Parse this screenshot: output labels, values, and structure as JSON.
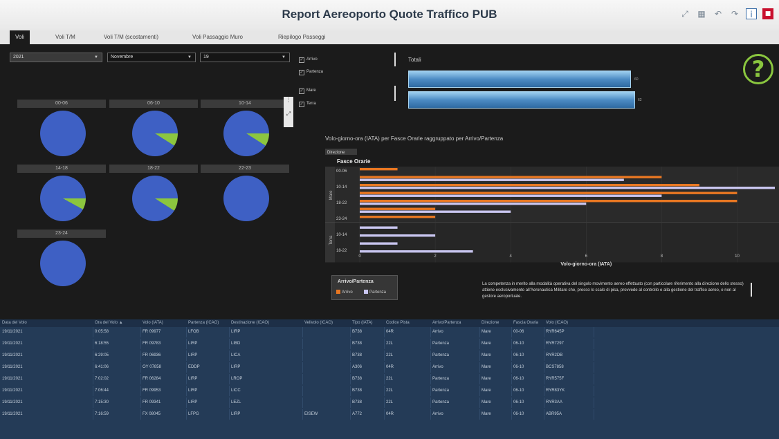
{
  "title": "Report Aereoporto Quote Traffico PUB",
  "toolbar": {
    "icons": [
      "expand-icon",
      "grid-icon",
      "undo-icon",
      "redo-icon",
      "info-icon",
      "app-icon"
    ]
  },
  "tabs": [
    "Voli",
    "Voli T/M",
    "Voli T/M (scostamenti)",
    "Voli Passaggio Muro",
    "Riepilogo Passeggi"
  ],
  "filters": {
    "year": "2021",
    "month": "Novembre",
    "day": "19"
  },
  "checkboxes": [
    {
      "label": "Arrivo",
      "checked": true
    },
    {
      "label": "Partenza",
      "checked": true
    },
    {
      "label": "Mare",
      "checked": true
    },
    {
      "label": "Terra",
      "checked": true
    }
  ],
  "pies": [
    {
      "label": "00-06",
      "green_pct": 0
    },
    {
      "label": "06-10",
      "green_pct": 9
    },
    {
      "label": "10-14",
      "green_pct": 9
    },
    {
      "label": "14-18",
      "green_pct": 8
    },
    {
      "label": "18-22",
      "green_pct": 9
    },
    {
      "label": "22-23",
      "green_pct": 0
    },
    {
      "label": "23-24",
      "green_pct": 0
    }
  ],
  "pie_colors": {
    "blue": "#3e60c4",
    "green": "#8cc63f"
  },
  "totals": {
    "title": "Totali",
    "bars": [
      {
        "label": "60"
      },
      {
        "label": "62"
      }
    ]
  },
  "help_icon": "?",
  "chart_data": {
    "type": "bar",
    "title": "Volo-giorno-ora (IATA) per Fasce Orarie raggruppato per Arrivo/Partenza",
    "xlabel": "Volo-giorno-ora (IATA)",
    "y_group_header": "Direzione",
    "y_header": "Fasce Orarie",
    "xlim": [
      0,
      11
    ],
    "xticks": [
      0,
      2,
      4,
      6,
      8,
      10
    ],
    "rows": [
      {
        "group": "Mare",
        "label": "00-06",
        "arrivo": 1,
        "partenza": 0
      },
      {
        "group": "Mare",
        "label": "06-10",
        "arrivo": 8,
        "partenza": 7
      },
      {
        "group": "Mare",
        "label": "10-14",
        "arrivo": 9,
        "partenza": 11
      },
      {
        "group": "Mare",
        "label": "14-18",
        "arrivo": 10,
        "partenza": 8
      },
      {
        "group": "Mare",
        "label": "18-22",
        "arrivo": 10,
        "partenza": 6
      },
      {
        "group": "Mare",
        "label": "22-23",
        "arrivo": 2,
        "partenza": 4
      },
      {
        "group": "Mare",
        "label": "23-24",
        "arrivo": 2,
        "partenza": 0
      },
      {
        "group": "Terra",
        "label": "06-10",
        "arrivo": 0,
        "partenza": 1
      },
      {
        "group": "Terra",
        "label": "10-14",
        "arrivo": 0,
        "partenza": 2
      },
      {
        "group": "Terra",
        "label": "14-18",
        "arrivo": 0,
        "partenza": 1
      },
      {
        "group": "Terra",
        "label": "18-22",
        "arrivo": 0,
        "partenza": 3
      }
    ],
    "shown_row_labels": [
      "00-06",
      "10-14",
      "18-22",
      "23-24",
      "06-10",
      "14-18"
    ],
    "legend": {
      "title": "Arrivo/Partenza",
      "items": [
        "Arrivo",
        "Partenza"
      ],
      "position": "bottom-left"
    },
    "colors": {
      "arrivo": "#e87722",
      "partenza": "#c9c6f0"
    }
  },
  "note": "La competenza in merito alla modalità operativa del singolo movimento aereo effettuato (con particolare riferimento alla direzione dello stesso) attiene esclusivamente all'Aeronautica Militare che, presso lo scalo di pisa, provvede al controllo e alla gestione del traffico aereo, e non al gestore aeroportuale.",
  "table": {
    "columns": [
      "Data del Volo",
      "Ora del Volo ▲",
      "Volo (IATA)",
      "Partenza (ICAO)",
      "Destinazione (ICAO)",
      "Velivolo (ICAO)",
      "Tipo (IATA)",
      "Codice Pista",
      "Arrivo/Partenza",
      "Direzione",
      "Fascia Oraria",
      "Volo (ICAO)"
    ],
    "rows": [
      [
        "19/11/2021",
        "0:05:58",
        "FR 09977",
        "LFOB",
        "LIRP",
        "",
        "B738",
        "04R",
        "Arrivo",
        "Mare",
        "00-06",
        "RYR645P"
      ],
      [
        "19/11/2021",
        "6:18:55",
        "FR 09783",
        "LIRP",
        "LIBD",
        "",
        "B738",
        "22L",
        "Partenza",
        "Mare",
        "06-10",
        "RYR7297"
      ],
      [
        "19/11/2021",
        "6:29:05",
        "FR 06936",
        "LIRP",
        "LICA",
        "",
        "B738",
        "22L",
        "Partenza",
        "Mare",
        "06-10",
        "RYR2DB"
      ],
      [
        "19/11/2021",
        "6:41:06",
        "OY 07858",
        "EDDP",
        "LIRP",
        "",
        "A306",
        "04R",
        "Arrivo",
        "Mare",
        "06-10",
        "BCS7858"
      ],
      [
        "19/11/2021",
        "7:02:02",
        "FR 06284",
        "LIRP",
        "LROP",
        "",
        "B738",
        "22L",
        "Partenza",
        "Mare",
        "06-10",
        "RYR575F"
      ],
      [
        "19/11/2021",
        "7:06:44",
        "FR 09953",
        "LIRP",
        "LICC",
        "",
        "B738",
        "22L",
        "Partenza",
        "Mare",
        "06-10",
        "RYR83YK"
      ],
      [
        "19/11/2021",
        "7:15:30",
        "FR 09341",
        "LIRP",
        "LEZL",
        "",
        "B738",
        "22L",
        "Partenza",
        "Mare",
        "06-10",
        "RYR3AA"
      ],
      [
        "19/11/2021",
        "7:16:59",
        "FX 08045",
        "LFPG",
        "LIRP",
        "EISEW",
        "A772",
        "04R",
        "Arrivo",
        "Mare",
        "06-10",
        "ABR95A"
      ]
    ]
  }
}
